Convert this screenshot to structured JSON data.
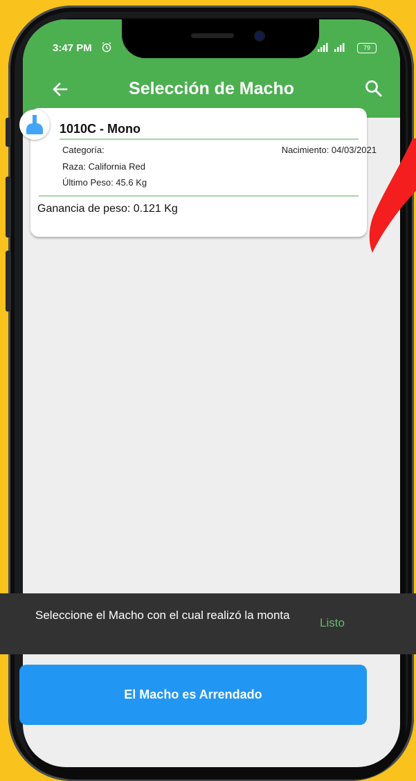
{
  "status_bar": {
    "time": "3:47 PM",
    "battery": "79"
  },
  "toolbar": {
    "title": "Selección de Macho"
  },
  "card": {
    "title": "1010C - Mono",
    "category": "Categoría:",
    "birth": "Nacimiento: 04/03/2021",
    "breed": "Raza: California Red",
    "last_weight": "Último Peso: 45.6 Kg",
    "weight_gain": "Ganancia de peso: 0.121 Kg"
  },
  "snackbar": {
    "message": "Seleccione el Macho con el cual realizó la monta",
    "action": "Listo"
  },
  "button": {
    "label": "El Macho es Arrendado"
  },
  "colors": {
    "background": "#F9C21C",
    "app_bar": "#4CAF50",
    "button": "#2196F3",
    "snackbar": "#323232",
    "snackbar_action": "#66BB6A",
    "tag_icon": "#42A5F5",
    "red_mark": "#F41E1E"
  },
  "icons": {
    "back": "arrow-left-icon",
    "search": "search-icon",
    "alarm": "alarm-clock-icon",
    "signal": "signal-icon",
    "tag": "ear-tag-icon"
  }
}
